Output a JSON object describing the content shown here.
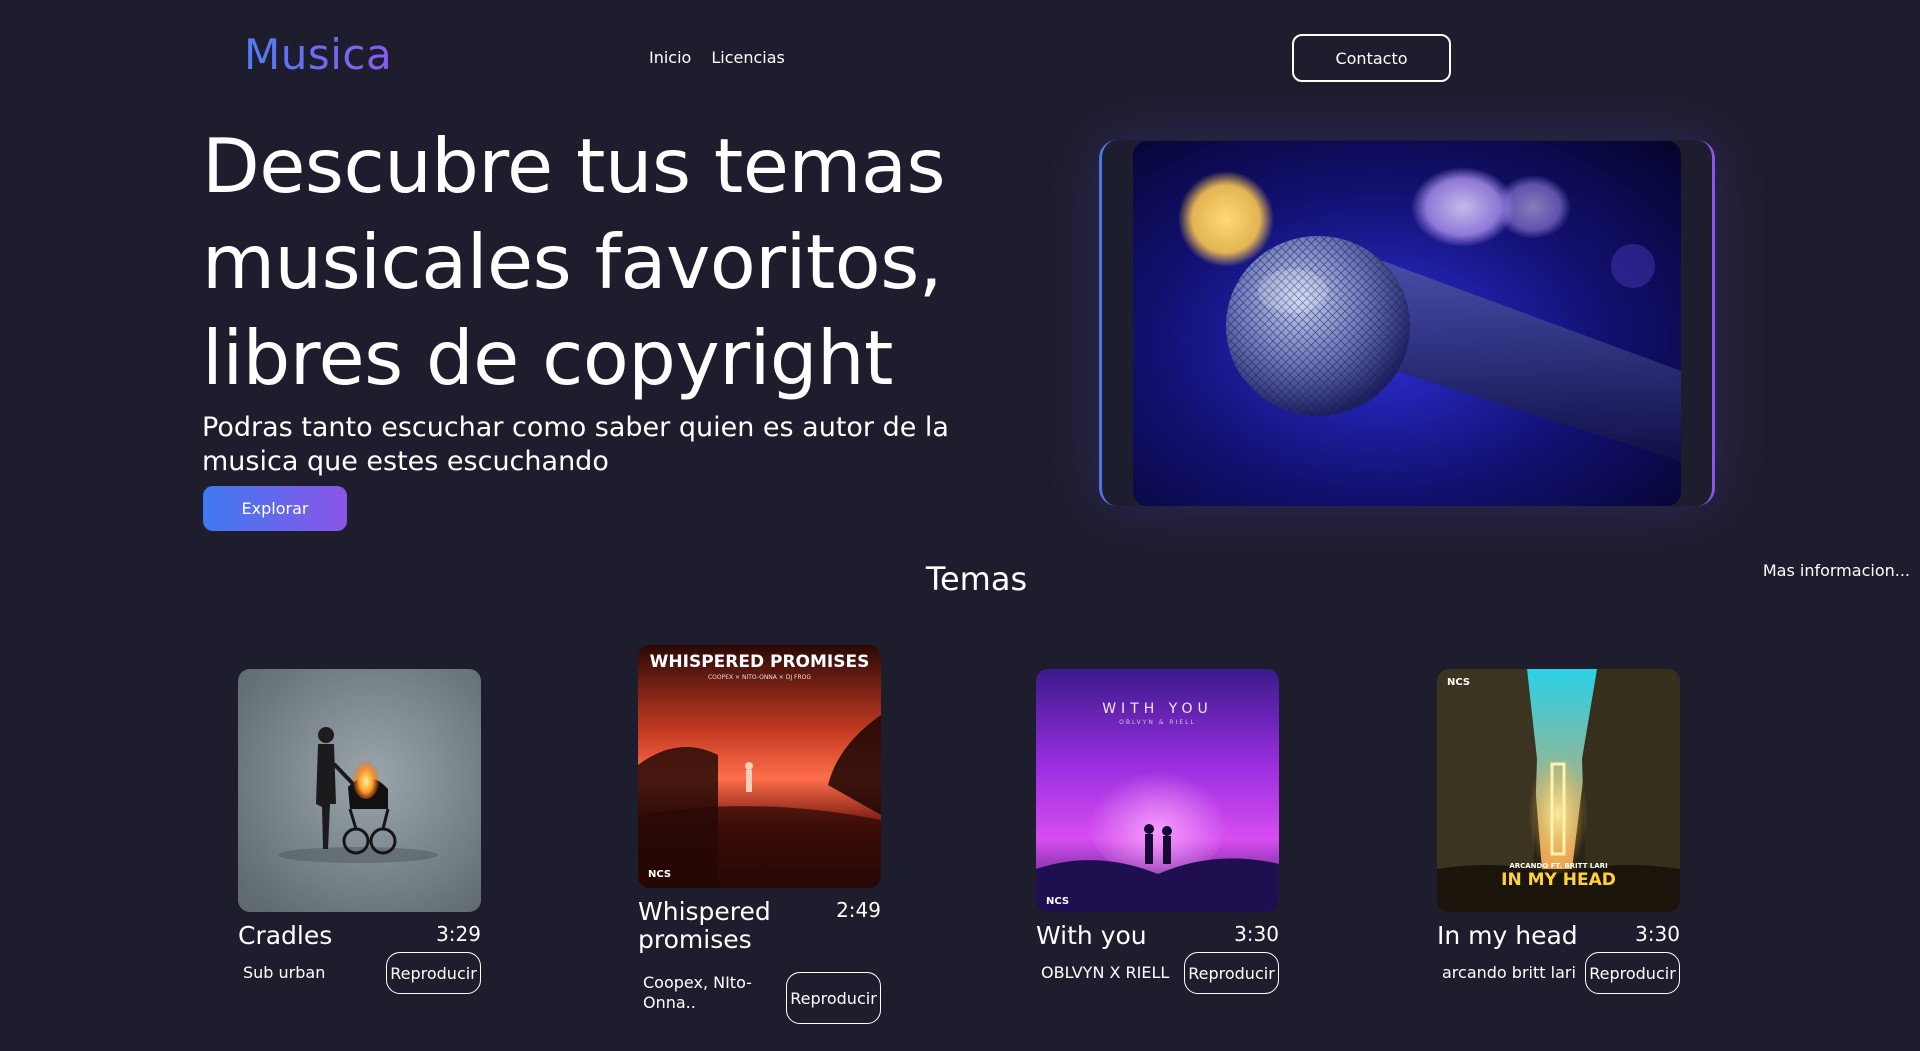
{
  "header": {
    "logo": "Musica",
    "nav": [
      "Inicio",
      "Licencias"
    ],
    "contact_label": "Contacto"
  },
  "hero": {
    "title": "Descubre tus temas musicales favoritos, libres de copyright",
    "subtitle": "Podras tanto escuchar como saber quien es autor de la musica que estes escuchando",
    "explore_label": "Explorar",
    "image_icon": "microphone-image"
  },
  "section": {
    "title": "Temas",
    "more_info": "Mas informacion..."
  },
  "tracks": [
    {
      "title": "Cradles",
      "duration": "3:29",
      "artist": "Sub urban",
      "play_label": "Reproducir",
      "cover_icon": "cradles-cover"
    },
    {
      "title": "Whispered promises",
      "duration": "2:49",
      "artist": "Coopex, NIto-Onna..",
      "play_label": "Reproducir",
      "cover_icon": "whispered-promises-cover",
      "cover_text": "WHISPERED PROMISES",
      "cover_subtext": "COOPEX × NITO-ONNA × DJ FROG",
      "cover_brand": "NCS"
    },
    {
      "title": "With you",
      "duration": "3:30",
      "artist": "OBLVYN X RIELL",
      "play_label": "Reproducir",
      "cover_icon": "with-you-cover",
      "cover_text": "WITH YOU",
      "cover_subtext": "OBLVYN & RIELL",
      "cover_brand": "NCS"
    },
    {
      "title": "In my head",
      "duration": "3:30",
      "artist": "arcando britt lari",
      "play_label": "Reproducir",
      "cover_icon": "in-my-head-cover",
      "cover_text": "IN MY HEAD",
      "cover_subtext": "ARCANDO FT. BRITT LARI",
      "cover_brand": "NCS"
    }
  ],
  "colors": {
    "background": "#1e1d2e",
    "accent_blue": "#3f7af0",
    "accent_purple": "#8a55e8"
  }
}
